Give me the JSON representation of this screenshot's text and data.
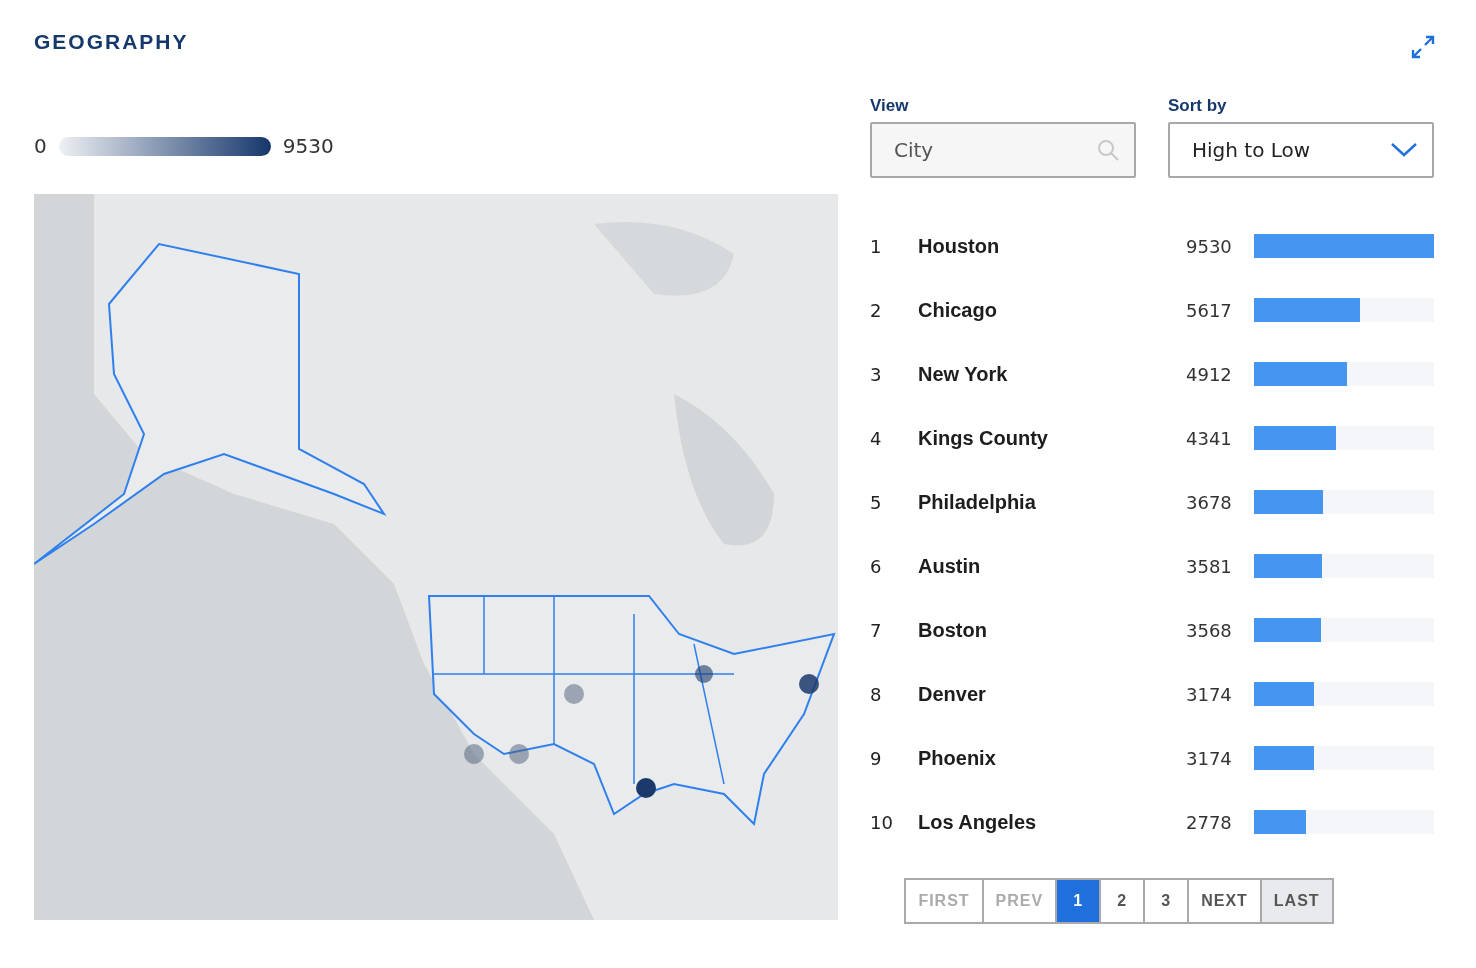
{
  "title": "GEOGRAPHY",
  "legend": {
    "min": "0",
    "max": "9530"
  },
  "view": {
    "label": "View",
    "placeholder": "City"
  },
  "sort": {
    "label": "Sort by",
    "value": "High to Low"
  },
  "rows": [
    {
      "rank": "1",
      "name": "Houston",
      "value": "9530",
      "level": 1.0
    },
    {
      "rank": "2",
      "name": "Chicago",
      "value": "5617",
      "level": 0.589
    },
    {
      "rank": "3",
      "name": "New York",
      "value": "4912",
      "level": 0.515
    },
    {
      "rank": "4",
      "name": "Kings County",
      "value": "4341",
      "level": 0.456
    },
    {
      "rank": "5",
      "name": "Philadelphia",
      "value": "3678",
      "level": 0.386
    },
    {
      "rank": "6",
      "name": "Austin",
      "value": "3581",
      "level": 0.376
    },
    {
      "rank": "7",
      "name": "Boston",
      "value": "3568",
      "level": 0.374
    },
    {
      "rank": "8",
      "name": "Denver",
      "value": "3174",
      "level": 0.333
    },
    {
      "rank": "9",
      "name": "Phoenix",
      "value": "3174",
      "level": 0.333
    },
    {
      "rank": "10",
      "name": "Los Angeles",
      "value": "2778",
      "level": 0.291
    }
  ],
  "pagination": [
    {
      "label": "FIRST",
      "disabled": true,
      "selected": false,
      "hovered": false
    },
    {
      "label": "PREV",
      "disabled": true,
      "selected": false,
      "hovered": false
    },
    {
      "label": "1",
      "disabled": false,
      "selected": true,
      "hovered": false
    },
    {
      "label": "2",
      "disabled": false,
      "selected": false,
      "hovered": false
    },
    {
      "label": "3",
      "disabled": false,
      "selected": false,
      "hovered": false
    },
    {
      "label": "NEXT",
      "disabled": false,
      "selected": false,
      "hovered": false
    },
    {
      "label": "LAST",
      "disabled": false,
      "selected": false,
      "hovered": true
    }
  ]
}
